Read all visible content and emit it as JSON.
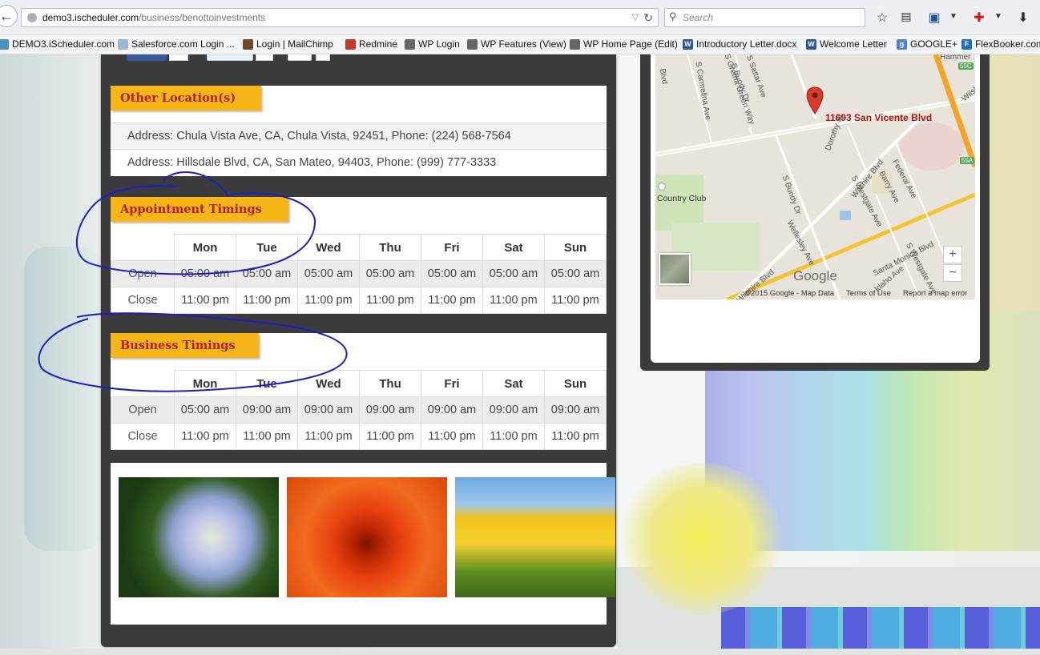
{
  "browser": {
    "url_host": "demo3.ischeduler.com",
    "url_path": "/business/benottoinvestments",
    "search_placeholder": "Search"
  },
  "bookmarks": [
    {
      "label": "DEMO3.iScheduler.com",
      "icon": "ischeduler-icon",
      "color": "#4a90c2"
    },
    {
      "label": "Salesforce.com Login ...",
      "icon": "cloud-icon",
      "color": "#9bb7d4"
    },
    {
      "label": "Login | MailChimp",
      "icon": "mailchimp-icon",
      "color": "#6b4a2b"
    },
    {
      "label": "Redmine",
      "icon": "redmine-icon",
      "color": "#c0392b"
    },
    {
      "label": "WP Login",
      "icon": "wordpress-icon",
      "color": "#666666"
    },
    {
      "label": "WP Features (View)",
      "icon": "wordpress-icon",
      "color": "#666666"
    },
    {
      "label": "WP Home Page (Edit)",
      "icon": "wordpress-icon",
      "color": "#666666"
    },
    {
      "label": "Introductory Letter.docx",
      "icon": "word-doc-icon",
      "color": "#2b579a"
    },
    {
      "label": "Welcome Letter",
      "icon": "word-doc-icon",
      "color": "#2b579a"
    },
    {
      "label": "GOOGLE+",
      "icon": "google-icon",
      "color": "#4f7fd6"
    },
    {
      "label": "FlexBooker.com",
      "icon": "flexbooker-icon",
      "color": "#1f6fb8"
    }
  ],
  "other_locations": {
    "title": "Other Location(s)",
    "addresses": [
      "Address: Chula Vista Ave, CA, Chula Vista, 92451, Phone: (224) 568-7564",
      "Address: Hillsdale Blvd, CA, San Mateo, 94403, Phone: (999) 777-3333"
    ]
  },
  "days": [
    "Mon",
    "Tue",
    "Wed",
    "Thu",
    "Fri",
    "Sat",
    "Sun"
  ],
  "appointment_timings": {
    "title": "Appointment Timings",
    "open_label": "Open",
    "close_label": "Close",
    "open": [
      "05:00 am",
      "05:00 am",
      "05:00 am",
      "05:00 am",
      "05:00 am",
      "05:00 am",
      "05:00 am"
    ],
    "close": [
      "11:00 pm",
      "11:00 pm",
      "11:00 pm",
      "11:00 pm",
      "11:00 pm",
      "11:00 pm",
      "11:00 pm"
    ]
  },
  "business_timings": {
    "title": "Business Timings",
    "open_label": "Open",
    "close_label": "Close",
    "open": [
      "05:00 am",
      "09:00 am",
      "09:00 am",
      "09:00 am",
      "09:00 am",
      "09:00 am",
      "09:00 am"
    ],
    "close": [
      "11:00 pm",
      "11:00 pm",
      "11:00 pm",
      "11:00 pm",
      "11:00 pm",
      "11:00 pm",
      "11:00 pm"
    ]
  },
  "gallery": [
    {
      "name": "hydrangea-photo",
      "colors": [
        "#1c3a12",
        "#b8c2e8",
        "#e6ecd2"
      ]
    },
    {
      "name": "chrysanthemum-photo",
      "colors": [
        "#8a1400",
        "#e8420f",
        "#f26b1d"
      ]
    },
    {
      "name": "tulips-photo",
      "colors": [
        "#6fa8e0",
        "#f2c21a",
        "#4a7a1c"
      ]
    }
  ],
  "map": {
    "pin_label": "11693 San Vicente Blvd",
    "place_label": "Country Club",
    "streets": [
      "Wilshire Blvd",
      "S Bundy Dr",
      "Santa Monica Blvd",
      "Federal Ave",
      "Barry Ave",
      "S Westgate Ave",
      "Dorothy St",
      "Wellesley Ave",
      "Idaho Ave",
      "S Westgate Ave",
      "S Sattar Ave",
      "S Bundy Dr",
      "S Gretna Green Way",
      "S Carmelina Ave",
      "Wilshire Blvd",
      "Hammer",
      "Wilshire",
      "Blvd"
    ],
    "zoom_in": "+",
    "zoom_out": "−",
    "google": "Google",
    "attribution": "©2015 Google - Map Data",
    "terms": "Terms of Use",
    "report": "Report a map error",
    "highway_badges": [
      "55C",
      "55A"
    ],
    "colors": {
      "pin": "#d93a2b",
      "freeway": "#f2a624",
      "park": "#cfe3b8"
    }
  }
}
